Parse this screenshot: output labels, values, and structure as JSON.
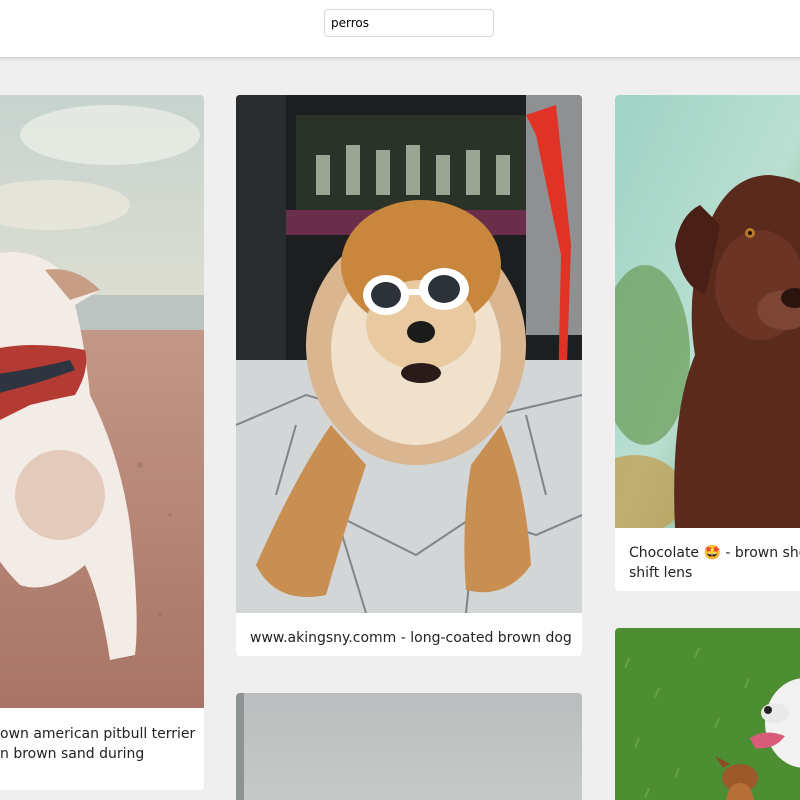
{
  "search": {
    "value": "perros"
  },
  "results": [
    {
      "caption_line1": "own american pitbull terrier",
      "caption_line2": "n brown sand during"
    },
    {
      "caption_line1": "www.akingsny.comm - long-coated brown dog"
    },
    {
      "caption_line1": "Chocolate 🤩 - brown sho",
      "caption_line2": "shift lens"
    }
  ],
  "colors": {
    "page_bg": "#efefef",
    "card_bg": "#ffffff",
    "topbar_bg": "#ffffff"
  }
}
